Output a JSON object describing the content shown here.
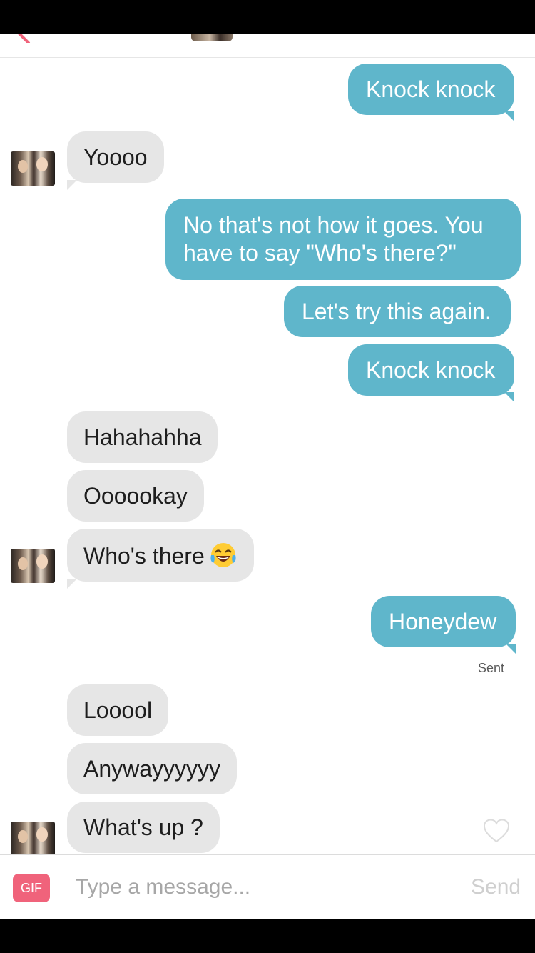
{
  "colors": {
    "outgoing_bubble": "#5fb6cb",
    "incoming_bubble": "#e6e6e6",
    "gif_button": "#f0637b",
    "send_disabled": "#cfcfcf"
  },
  "messages": [
    {
      "direction": "outgoing",
      "text": "Knock knock"
    },
    {
      "direction": "incoming",
      "text": "Yoooo"
    },
    {
      "direction": "outgoing",
      "text": "No that's not how it goes. You have to say \"Who's there?\""
    },
    {
      "direction": "outgoing",
      "text": "Let's try this again."
    },
    {
      "direction": "outgoing",
      "text": "Knock knock"
    },
    {
      "direction": "incoming",
      "text": "Hahahahha"
    },
    {
      "direction": "incoming",
      "text": "Oooookay"
    },
    {
      "direction": "incoming",
      "text": "Who's there",
      "emoji": "face-with-tears-of-joy"
    },
    {
      "direction": "outgoing",
      "text": "Honeydew"
    },
    {
      "direction": "incoming",
      "text": "Looool"
    },
    {
      "direction": "incoming",
      "text": "Anywayyyyyy"
    },
    {
      "direction": "incoming",
      "text": "What's up ?"
    }
  ],
  "status": {
    "sent_label": "Sent"
  },
  "composer": {
    "gif_label": "GIF",
    "placeholder": "Type a message...",
    "send_label": "Send"
  },
  "icons": [
    "back-arrow-icon",
    "avatar",
    "heart-icon",
    "face-with-tears-of-joy-icon"
  ]
}
